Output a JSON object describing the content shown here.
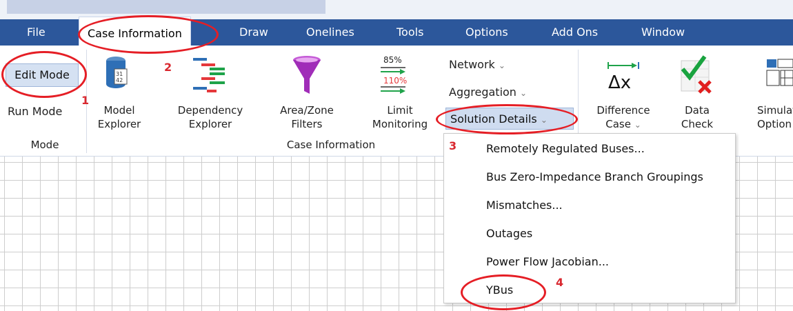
{
  "menubar": {
    "tabs": [
      "File",
      "Case Information",
      "Draw",
      "Onelines",
      "Tools",
      "Options",
      "Add Ons",
      "Window"
    ]
  },
  "mode_group": {
    "edit_mode": "Edit Mode",
    "run_mode": "Run Mode",
    "label": "Mode"
  },
  "case_info_group": {
    "model_explorer": [
      "Model",
      "Explorer"
    ],
    "dependency_explorer": [
      "Dependency",
      "Explorer"
    ],
    "area_zone_filters": [
      "Area/Zone",
      "Filters"
    ],
    "limit_monitoring": [
      "Limit",
      "Monitoring"
    ],
    "limit_icon_top": "85%",
    "limit_icon_bottom": "110%",
    "network": "Network",
    "aggregation": "Aggregation",
    "solution_details": "Solution Details",
    "label": "Case Information"
  },
  "right_group": {
    "difference_case": [
      "Difference",
      "Case"
    ],
    "data_check": [
      "Data",
      "Check"
    ],
    "simulator_options": [
      "Simulato",
      "Option"
    ]
  },
  "dropdown": {
    "items": [
      "Remotely Regulated Buses...",
      "Bus Zero-Impedance Branch Groupings",
      "Mismatches...",
      "Outages",
      "Power Flow Jacobian...",
      "YBus"
    ]
  },
  "annotations": [
    "1",
    "2",
    "3",
    "4"
  ],
  "colors": {
    "menubar": "#2c579b",
    "annotation": "#e51e25"
  }
}
